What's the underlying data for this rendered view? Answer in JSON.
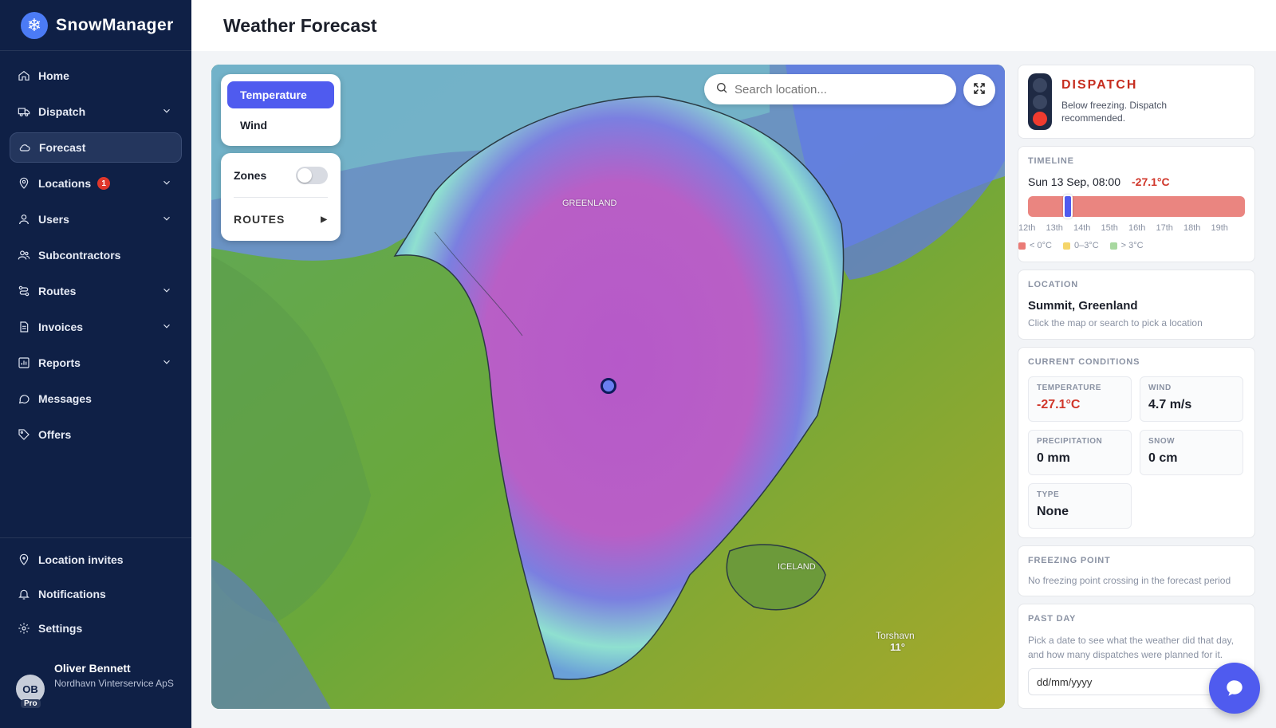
{
  "brand": {
    "name": "SnowManager",
    "logo_icon": "snowflake-icon"
  },
  "nav": {
    "items": [
      {
        "label": "Home",
        "icon": "home-icon"
      },
      {
        "label": "Dispatch",
        "icon": "truck-icon"
      },
      {
        "label": "Forecast",
        "icon": "cloud-icon",
        "active": true
      },
      {
        "label": "Locations",
        "icon": "map-pin-icon",
        "badge": "1"
      },
      {
        "label": "Users",
        "icon": "user-icon"
      },
      {
        "label": "Subcontractors",
        "icon": "users-icon"
      },
      {
        "label": "Routes",
        "icon": "route-icon"
      },
      {
        "label": "Invoices",
        "icon": "file-icon"
      },
      {
        "label": "Reports",
        "icon": "chart-icon"
      },
      {
        "label": "Messages",
        "icon": "message-icon"
      },
      {
        "label": "Offers",
        "icon": "tag-icon"
      }
    ],
    "bottom": [
      {
        "label": "Location invites",
        "icon": "invite-icon"
      },
      {
        "label": "Notifications",
        "icon": "bell-icon"
      },
      {
        "label": "Settings",
        "icon": "gear-icon"
      }
    ]
  },
  "user": {
    "initials": "OB",
    "plan": "Pro",
    "name": "Oliver Bennett",
    "org": "Nordhavn Vinterservice ApS"
  },
  "header": {
    "title": "Weather Forecast"
  },
  "map": {
    "layers": [
      "Temperature",
      "Wind"
    ],
    "selected_layer": "Temperature",
    "zones_label": "Zones",
    "zones_on": false,
    "routes_label": "ROUTES",
    "search_placeholder": "Search location...",
    "labels": {
      "greenland": "GREENLAND",
      "iceland": "ICELAND",
      "torshavn": "Torshavn",
      "torshavn_temp": "11°"
    }
  },
  "dispatch": {
    "title": "DISPATCH",
    "desc": "Below freezing. Dispatch recommended.",
    "status_color": "#f03b2f"
  },
  "timeline": {
    "title": "TIMELINE",
    "datetime": "Sun 13 Sep, 08:00",
    "temp": "-27.1°C",
    "days": [
      "12th",
      "13th",
      "14th",
      "15th",
      "16th",
      "17th",
      "18th",
      "19th"
    ],
    "legend": [
      {
        "label": "< 0°C",
        "color": "#ea7b76"
      },
      {
        "label": "0–3°C",
        "color": "#f5d56a"
      },
      {
        "label": "> 3°C",
        "color": "#a8d8a0"
      }
    ]
  },
  "location": {
    "title": "LOCATION",
    "name": "Summit, Greenland",
    "hint": "Click the map or search to pick a location"
  },
  "conditions": {
    "title": "CURRENT CONDITIONS",
    "temperature_label": "TEMPERATURE",
    "temperature": "-27.1°C",
    "wind_label": "WIND",
    "wind": "4.7 m/s",
    "precip_label": "PRECIPITATION",
    "precip": "0 mm",
    "snow_label": "SNOW",
    "snow": "0 cm",
    "type_label": "TYPE",
    "type": "None"
  },
  "freezing": {
    "title": "FREEZING POINT",
    "text": "No freezing point crossing in the forecast period"
  },
  "past_day": {
    "title": "PAST DAY",
    "text": "Pick a date to see what the weather did that day, and how many dispatches were planned for it.",
    "date_placeholder": "dd/mm/yyyy"
  }
}
